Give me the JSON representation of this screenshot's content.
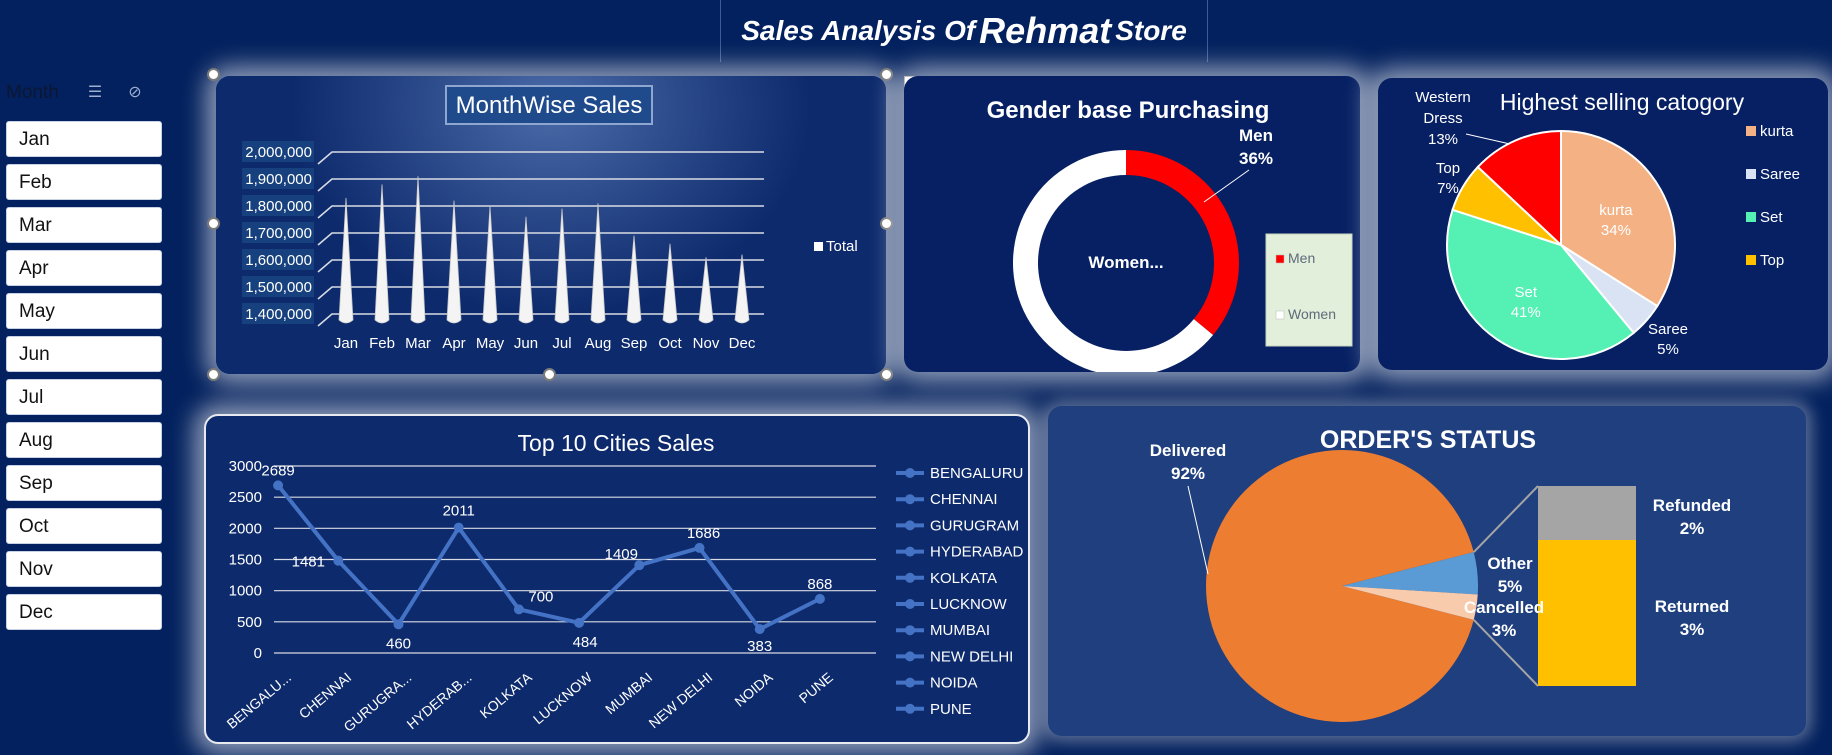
{
  "title": {
    "prefix": "Sales Analysis Of",
    "name": "Rehmat",
    "suffix": "Store"
  },
  "slicer": {
    "label": "Month",
    "items": [
      "Jan",
      "Feb",
      "Mar",
      "Apr",
      "May",
      "Jun",
      "Jul",
      "Aug",
      "Sep",
      "Oct",
      "Nov",
      "Dec"
    ]
  },
  "chart_data": [
    {
      "id": "monthwise",
      "type": "bar",
      "title": "MonthWise Sales",
      "legend": "Total",
      "legend_position": "right",
      "categories": [
        "Jan",
        "Feb",
        "Mar",
        "Apr",
        "May",
        "Jun",
        "Jul",
        "Aug",
        "Sep",
        "Oct",
        "Nov",
        "Dec"
      ],
      "values": [
        1830000,
        1880000,
        1910000,
        1820000,
        1800000,
        1760000,
        1790000,
        1810000,
        1690000,
        1660000,
        1610000,
        1620000
      ],
      "yticks": [
        "2,000,000",
        "1,900,000",
        "1,800,000",
        "1,700,000",
        "1,600,000",
        "1,500,000",
        "1,400,000"
      ],
      "ylim": [
        1400000,
        2000000
      ],
      "grid": true
    },
    {
      "id": "gender",
      "type": "pie",
      "title": "Gender base Purchasing",
      "categories": [
        "Men",
        "Women"
      ],
      "values": [
        36,
        64
      ],
      "labels": [
        "Men 36%",
        "Women..."
      ],
      "colors": [
        "#ff0000",
        "#ffffff"
      ]
    },
    {
      "id": "category",
      "type": "pie",
      "title": "Highest selling catogory",
      "categories": [
        "kurta",
        "Saree",
        "Set",
        "Top",
        "Western Dress"
      ],
      "values": [
        34,
        5,
        41,
        7,
        13
      ],
      "legend": [
        "kurta",
        "Saree",
        "Set",
        "Top"
      ],
      "colors": [
        "#f4b183",
        "#dae3f3",
        "#55f0b4",
        "#ffc000",
        "#ff0000"
      ]
    },
    {
      "id": "cities",
      "type": "line",
      "title": "Top 10 Cities Sales",
      "categories": [
        "BENGALU...",
        "CHENNAI",
        "GURUGRA...",
        "HYDERAB...",
        "KOLKATA",
        "LUCKNOW",
        "MUMBAI",
        "NEW DELHI",
        "NOIDA",
        "PUNE"
      ],
      "values": [
        2689,
        1481,
        460,
        2011,
        700,
        484,
        1409,
        1686,
        383,
        868
      ],
      "legend": [
        "BENGALURU",
        "CHENNAI",
        "GURUGRAM",
        "HYDERABAD",
        "KOLKATA",
        "LUCKNOW",
        "MUMBAI",
        "NEW DELHI",
        "NOIDA",
        "PUNE"
      ],
      "ylim": [
        0,
        3000
      ],
      "yticks": [
        "3000",
        "2500",
        "2000",
        "1500",
        "1000",
        "500",
        "0"
      ],
      "grid": true
    },
    {
      "id": "orders",
      "type": "pie",
      "title": "ORDER'S STATUS",
      "categories": [
        "Delivered",
        "Other",
        "Cancelled"
      ],
      "values": [
        92,
        5,
        3
      ],
      "sub_breakdown": {
        "categories": [
          "Refunded",
          "Returned"
        ],
        "values": [
          2,
          3
        ]
      },
      "labels": {
        "delivered_name": "Delivered",
        "delivered_pct": "92%",
        "other_name": "Other",
        "other_pct": "5%",
        "cancelled_name": "Cancelled",
        "cancelled_pct": "3%",
        "refunded_name": "Refunded",
        "refunded_pct": "2%",
        "returned_name": "Returned",
        "returned_pct": "3%"
      },
      "colors": [
        "#ed7d31",
        "#5b9bd5",
        "#f8cbad",
        "#a5a5a5",
        "#ffc000"
      ]
    }
  ],
  "colors": {
    "background": "#03215e",
    "panel": "#0d2a6c",
    "accent_line": "#4472c4"
  }
}
